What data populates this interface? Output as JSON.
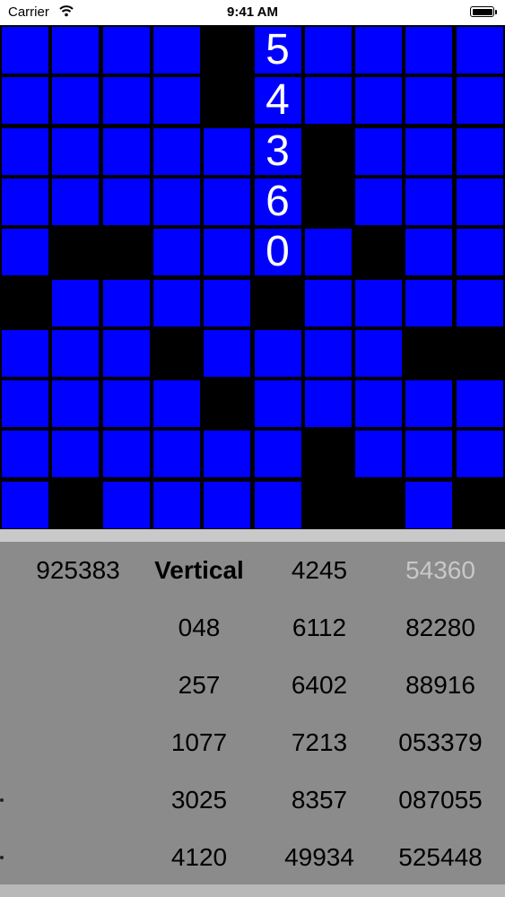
{
  "status_bar": {
    "carrier": "Carrier",
    "wifi_icon": "wifi-icon",
    "time": "9:41 AM",
    "battery_icon": "battery-icon"
  },
  "grid": {
    "rows": 10,
    "cols": 10,
    "colors": {
      "filled": "#0000ff",
      "empty": "#000000",
      "text": "#ffffff"
    },
    "cells": [
      [
        "B",
        "B",
        "B",
        "B",
        "X",
        "5",
        "B",
        "B",
        "B",
        "B"
      ],
      [
        "B",
        "B",
        "B",
        "B",
        "X",
        "4",
        "B",
        "B",
        "B",
        "B"
      ],
      [
        "B",
        "B",
        "B",
        "B",
        "B",
        "3",
        "X",
        "B",
        "B",
        "B"
      ],
      [
        "B",
        "B",
        "B",
        "B",
        "B",
        "6",
        "X",
        "B",
        "B",
        "B"
      ],
      [
        "B",
        "X",
        "X",
        "B",
        "B",
        "0",
        "B",
        "X",
        "B",
        "B"
      ],
      [
        "X",
        "B",
        "B",
        "B",
        "B",
        "X",
        "B",
        "B",
        "B",
        "B"
      ],
      [
        "B",
        "B",
        "B",
        "X",
        "B",
        "B",
        "B",
        "B",
        "X",
        "X"
      ],
      [
        "B",
        "B",
        "B",
        "B",
        "X",
        "B",
        "B",
        "B",
        "B",
        "B"
      ],
      [
        "B",
        "B",
        "B",
        "B",
        "B",
        "B",
        "X",
        "B",
        "B",
        "B"
      ],
      [
        "B",
        "X",
        "B",
        "B",
        "B",
        "B",
        "X",
        "X",
        "B",
        "X"
      ]
    ]
  },
  "word_list": {
    "columns": [
      {
        "items": [
          {
            "text": "925383",
            "style": "normal"
          }
        ]
      },
      {
        "items": [
          {
            "text": "Vertical",
            "style": "header"
          },
          {
            "text": "048",
            "style": "normal"
          },
          {
            "text": "257",
            "style": "normal"
          },
          {
            "text": "1077",
            "style": "normal"
          },
          {
            "text": "3025",
            "style": "normal"
          },
          {
            "text": "4120",
            "style": "normal"
          }
        ]
      },
      {
        "items": [
          {
            "text": "4245",
            "style": "normal"
          },
          {
            "text": "6112",
            "style": "normal"
          },
          {
            "text": "6402",
            "style": "normal"
          },
          {
            "text": "7213",
            "style": "normal"
          },
          {
            "text": "8357",
            "style": "normal"
          },
          {
            "text": "49934",
            "style": "normal"
          }
        ]
      },
      {
        "items": [
          {
            "text": "54360",
            "style": "dim"
          },
          {
            "text": "82280",
            "style": "normal"
          },
          {
            "text": "88916",
            "style": "normal"
          },
          {
            "text": "053379",
            "style": "normal"
          },
          {
            "text": "087055",
            "style": "normal"
          },
          {
            "text": "525448",
            "style": "normal"
          }
        ]
      }
    ]
  }
}
